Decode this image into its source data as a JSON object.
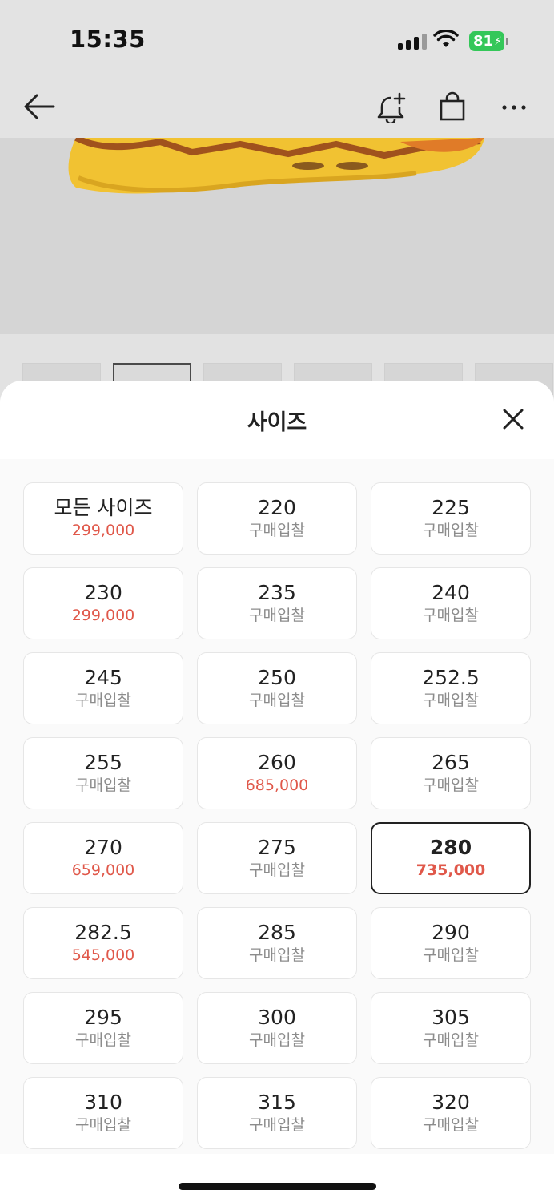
{
  "status_bar": {
    "time": "15:35",
    "battery": "81"
  },
  "sheet": {
    "title": "사이즈",
    "sizes": [
      {
        "size": "모든 사이즈",
        "sub": "299,000",
        "type": "price"
      },
      {
        "size": "220",
        "sub": "구매입찰",
        "type": "bid"
      },
      {
        "size": "225",
        "sub": "구매입찰",
        "type": "bid"
      },
      {
        "size": "230",
        "sub": "299,000",
        "type": "price"
      },
      {
        "size": "235",
        "sub": "구매입찰",
        "type": "bid"
      },
      {
        "size": "240",
        "sub": "구매입찰",
        "type": "bid"
      },
      {
        "size": "245",
        "sub": "구매입찰",
        "type": "bid"
      },
      {
        "size": "250",
        "sub": "구매입찰",
        "type": "bid"
      },
      {
        "size": "252.5",
        "sub": "구매입찰",
        "type": "bid"
      },
      {
        "size": "255",
        "sub": "구매입찰",
        "type": "bid"
      },
      {
        "size": "260",
        "sub": "685,000",
        "type": "price"
      },
      {
        "size": "265",
        "sub": "구매입찰",
        "type": "bid"
      },
      {
        "size": "270",
        "sub": "659,000",
        "type": "price"
      },
      {
        "size": "275",
        "sub": "구매입찰",
        "type": "bid"
      },
      {
        "size": "280",
        "sub": "735,000",
        "type": "price",
        "selected": true
      },
      {
        "size": "282.5",
        "sub": "545,000",
        "type": "price"
      },
      {
        "size": "285",
        "sub": "구매입찰",
        "type": "bid"
      },
      {
        "size": "290",
        "sub": "구매입찰",
        "type": "bid"
      },
      {
        "size": "295",
        "sub": "구매입찰",
        "type": "bid"
      },
      {
        "size": "300",
        "sub": "구매입찰",
        "type": "bid"
      },
      {
        "size": "305",
        "sub": "구매입찰",
        "type": "bid"
      },
      {
        "size": "310",
        "sub": "구매입찰",
        "type": "bid"
      },
      {
        "size": "315",
        "sub": "구매입찰",
        "type": "bid"
      },
      {
        "size": "320",
        "sub": "구매입찰",
        "type": "bid"
      }
    ]
  },
  "colors": {
    "price": "#e0584a",
    "selected_border": "#222222",
    "battery": "#34c759"
  },
  "icons": [
    "back-arrow-icon",
    "bell-plus-icon",
    "shopping-bag-icon",
    "more-icon",
    "close-icon"
  ]
}
